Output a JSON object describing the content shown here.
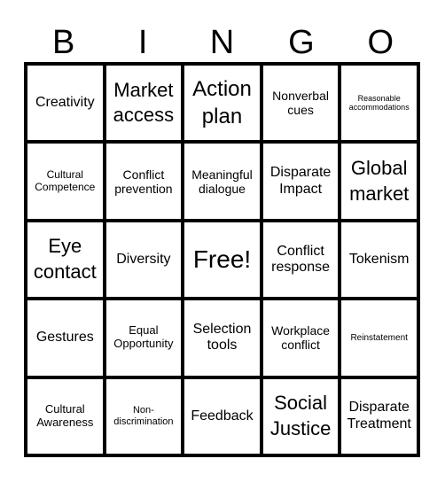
{
  "header": {
    "letters": [
      "B",
      "I",
      "N",
      "G",
      "O"
    ]
  },
  "grid": {
    "rows": [
      [
        "Creativity",
        "Market access",
        "Action plan",
        "Nonverbal cues",
        "Reasonable accommodations"
      ],
      [
        "Cultural Competence",
        "Conflict prevention",
        "Meaningful dialogue",
        "Disparate Impact",
        "Global market"
      ],
      [
        "Eye contact",
        "Diversity",
        "Free!",
        "Conflict response",
        "Tokenism"
      ],
      [
        "Gestures",
        "Equal Opportunity",
        "Selection tools",
        "Workplace conflict",
        "Reinstatement"
      ],
      [
        "Cultural Awareness",
        "Non-discrimination",
        "Feedback",
        "Social Justice",
        "Disparate Treatment"
      ]
    ]
  }
}
